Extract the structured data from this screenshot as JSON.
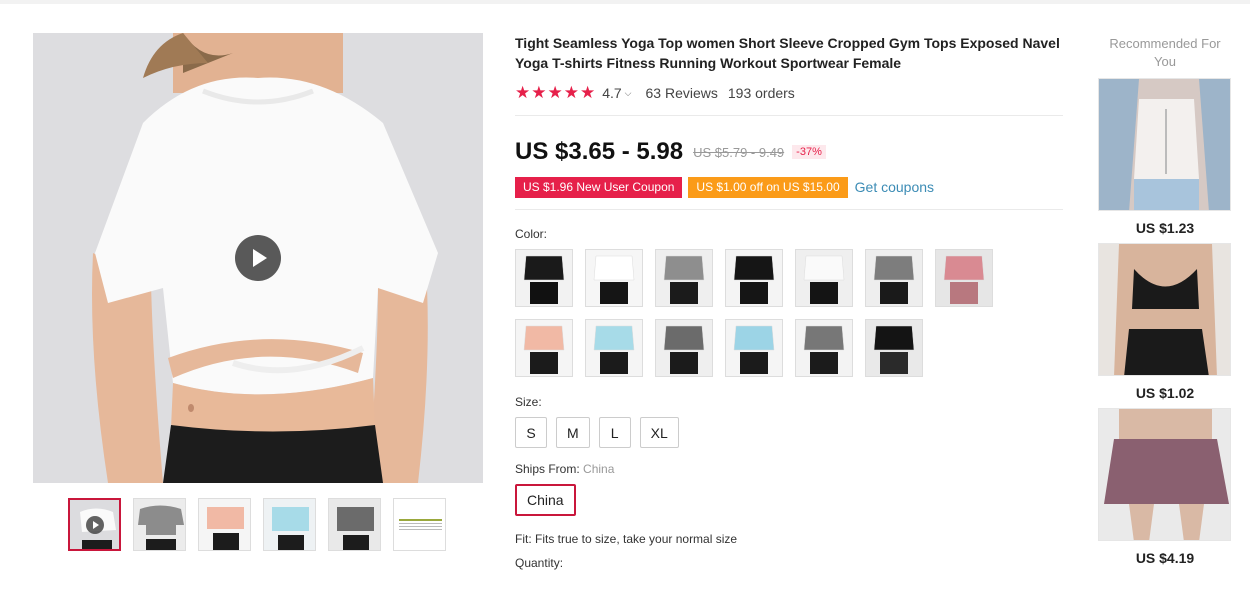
{
  "product": {
    "title": "Tight Seamless Yoga Top women Short Sleeve Cropped Gym Tops Exposed Navel Yoga T-shirts Fitness Running Workout Sportwear Female",
    "rating": "4.7",
    "reviews": "63 Reviews",
    "orders": "193 orders",
    "price": "US $3.65 - 5.98",
    "old_price": "US $5.79 - 9.49",
    "discount": "-37%"
  },
  "coupons": {
    "new_user": "US $1.96 New User Coupon",
    "off": "US $1.00 off on US $15.00",
    "get_coupons": "Get coupons"
  },
  "color": {
    "label": "Color:",
    "swatches": [
      {
        "name": "black-short-sleeve",
        "top": "#1a1a1a",
        "bottom": "#111111",
        "bg": "#f2f2f2"
      },
      {
        "name": "white-short-sleeve",
        "top": "#ffffff",
        "bottom": "#151515",
        "bg": "#f6f6f6"
      },
      {
        "name": "grey-short-sleeve",
        "top": "#8e8e8e",
        "bottom": "#1b1b1b",
        "bg": "#efefef"
      },
      {
        "name": "black-long-sleeve",
        "top": "#151515",
        "bottom": "#151515",
        "bg": "#f4f4f4"
      },
      {
        "name": "white-long-sleeve",
        "top": "#fafafa",
        "bottom": "#141414",
        "bg": "#efefef"
      },
      {
        "name": "grey-long-sleeve",
        "top": "#7d7d7d",
        "bottom": "#1a1a1a",
        "bg": "#eeeeee"
      },
      {
        "name": "pink-short-sleeve",
        "top": "#d98a92",
        "bottom": "#b8787f",
        "bg": "#e6e6e6"
      },
      {
        "name": "peach-long-sleeve",
        "top": "#f1b9a5",
        "bottom": "#1b1b1b",
        "bg": "#f5f5f5"
      },
      {
        "name": "sky-blue-long-sleeve",
        "top": "#a7dbe8",
        "bottom": "#1b1b1b",
        "bg": "#f5f5f5"
      },
      {
        "name": "dark-grey-long-sleeve",
        "top": "#6b6b6b",
        "bottom": "#1b1b1b",
        "bg": "#efefef"
      },
      {
        "name": "sky-blue-short-sleeve",
        "top": "#9cd4e6",
        "bottom": "#1b1b1b",
        "bg": "#f5f5f5"
      },
      {
        "name": "grey-short-sleeve-2",
        "top": "#777777",
        "bottom": "#1b1b1b",
        "bg": "#f3f3f3"
      },
      {
        "name": "black-tank-top",
        "top": "#141414",
        "bottom": "#2a2a2a",
        "bg": "#e9e9e9"
      }
    ]
  },
  "size": {
    "label": "Size:",
    "options": [
      "S",
      "M",
      "L",
      "XL"
    ]
  },
  "ships": {
    "label": "Ships From:",
    "selected": "China",
    "option": "China"
  },
  "fit": "Fit: Fits true to size, take your normal size",
  "quantity_label": "Quantity:",
  "recommended": {
    "title": "Recommended For You",
    "items": [
      {
        "price": "US $1.23"
      },
      {
        "price": "US $1.02"
      },
      {
        "price": "US $4.19"
      }
    ]
  },
  "colors": {
    "accent": "#e6204a",
    "orange": "#fb9b18",
    "link": "#3c8cb5",
    "selected_border": "#c9163b"
  }
}
